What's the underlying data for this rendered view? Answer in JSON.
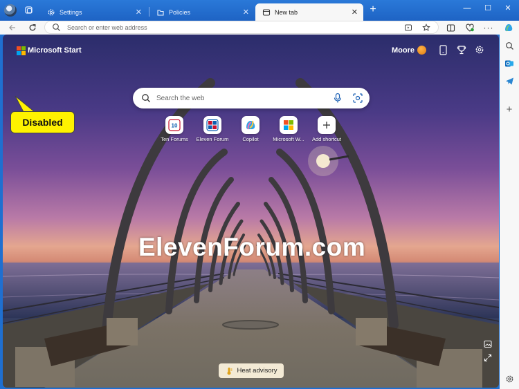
{
  "tabs": [
    {
      "label": "Settings",
      "active": false
    },
    {
      "label": "Policies",
      "active": false
    },
    {
      "label": "New tab",
      "active": true
    }
  ],
  "window": {
    "minimize": "—",
    "maximize": "☐",
    "close": "✕"
  },
  "addressbar": {
    "placeholder": "Search or enter web address"
  },
  "page": {
    "brand": "Microsoft Start",
    "user_name": "Moore",
    "callout": "Disabled",
    "search_placeholder": "Search the web",
    "shortcuts": [
      {
        "label": "Ten Forums",
        "icon": "ten-forums-icon"
      },
      {
        "label": "Eleven Forum",
        "icon": "eleven-forum-icon"
      },
      {
        "label": "Copilot",
        "icon": "copilot-icon"
      },
      {
        "label": "Microsoft W...",
        "icon": "microsoft-icon"
      },
      {
        "label": "Add shortcut",
        "icon": "plus-icon"
      }
    ],
    "watermark": "ElevenForum.com",
    "weather_alert": "Heat advisory"
  },
  "colors": {
    "tabstrip": "#1e63c4",
    "callout_bg": "#fff200",
    "ms_red": "#f25022",
    "ms_green": "#7fba00",
    "ms_blue": "#00a4ef",
    "ms_yellow": "#ffb900"
  }
}
